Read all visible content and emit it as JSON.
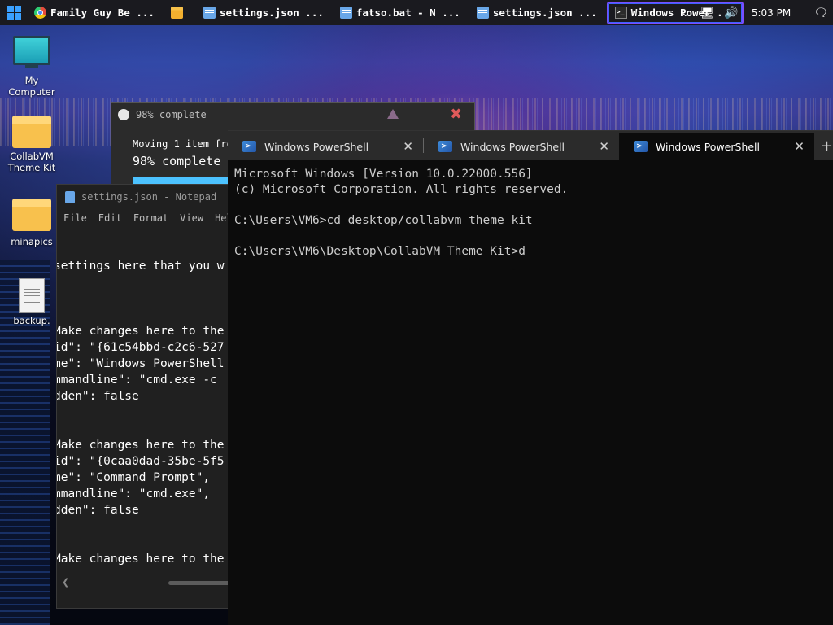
{
  "taskbar": {
    "items": [
      {
        "label": "Family Guy Be ...",
        "icon": "chrome-icon"
      },
      {
        "label": "",
        "icon": "folder-icon"
      },
      {
        "label": "settings.json ...",
        "icon": "notepad-icon"
      },
      {
        "label": "fatso.bat - N ...",
        "icon": "notepad-icon"
      },
      {
        "label": "settings.json ...",
        "icon": "notepad-icon"
      },
      {
        "label": "Windows Power ...",
        "icon": "powershell-icon",
        "active": true
      }
    ],
    "tray": {
      "chevron": "⌄",
      "clock": "5:03 PM"
    }
  },
  "desktop_icons": [
    {
      "label": "My Computer",
      "icon": "computer-icon"
    },
    {
      "label": "CollabVM Theme Kit",
      "icon": "folder-icon"
    },
    {
      "label": "minapics",
      "icon": "folder-icon"
    },
    {
      "label": "backup.",
      "icon": "file-icon"
    }
  ],
  "progress_dialog": {
    "title": "98% complete",
    "line1": "Moving 1 item fro",
    "line2": "98% complete",
    "percent": 98
  },
  "notepad": {
    "title": "settings.json - Notepad",
    "menu": [
      "File",
      "Edit",
      "Format",
      "View",
      "Hel"
    ],
    "lines": [
      "settings here that you w",
      "",
      "",
      "",
      "Make changes here to the",
      "id\": \"{61c54bbd-c2c6-527",
      "me\": \"Windows PowerShell",
      "mmandline\": \"cmd.exe -c ",
      "dden\": false",
      "",
      "",
      "Make changes here to the",
      "id\": \"{0caa0dad-35be-5f5",
      "me\": \"Command Prompt\",",
      "mmandline\": \"cmd.exe\",",
      "dden\": false",
      "",
      "",
      "Make changes here to the"
    ]
  },
  "terminal": {
    "tabs": [
      {
        "label": "Windows PowerShell"
      },
      {
        "label": "Windows PowerShell"
      },
      {
        "label": "Windows PowerShell",
        "active": true
      }
    ],
    "lines": [
      "Microsoft Windows [Version 10.0.22000.556]",
      "(c) Microsoft Corporation. All rights reserved.",
      "",
      "C:\\Users\\VM6>cd desktop/collabvm theme kit",
      "",
      "C:\\Users\\VM6\\Desktop\\CollabVM Theme Kit>d"
    ]
  }
}
